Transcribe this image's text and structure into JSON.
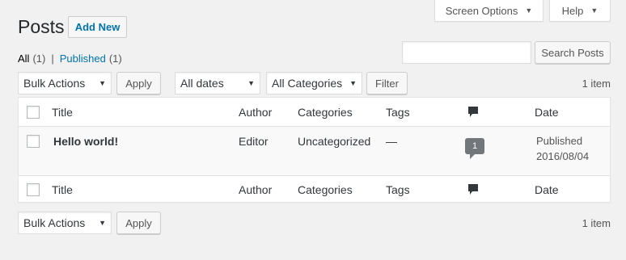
{
  "screen_tabs": {
    "screen_options": "Screen Options",
    "help": "Help"
  },
  "header": {
    "title": "Posts",
    "add_new": "Add New"
  },
  "status_filters": {
    "all_label": "All",
    "all_count": "(1)",
    "separator": "|",
    "published_label": "Published",
    "published_count": "(1)"
  },
  "search": {
    "placeholder": "",
    "button": "Search Posts"
  },
  "tablenav_top": {
    "bulk_actions": "Bulk Actions",
    "apply": "Apply",
    "dates": "All dates",
    "categories": "All Categories",
    "filter": "Filter",
    "item_count": "1 item"
  },
  "columns": {
    "title": "Title",
    "author": "Author",
    "categories": "Categories",
    "tags": "Tags",
    "comments_icon": "comment-icon",
    "date": "Date"
  },
  "posts": [
    {
      "title": "Hello world!",
      "author": "Editor",
      "categories": "Uncategorized",
      "tags": "—",
      "comments": "1",
      "date_status": "Published",
      "date": "2016/08/04"
    }
  ],
  "tablenav_bottom": {
    "bulk_actions": "Bulk Actions",
    "apply": "Apply",
    "item_count": "1 item"
  },
  "colors": {
    "link": "#0073aa",
    "background": "#f1f1f1",
    "comment_bubble": "#72777c"
  }
}
